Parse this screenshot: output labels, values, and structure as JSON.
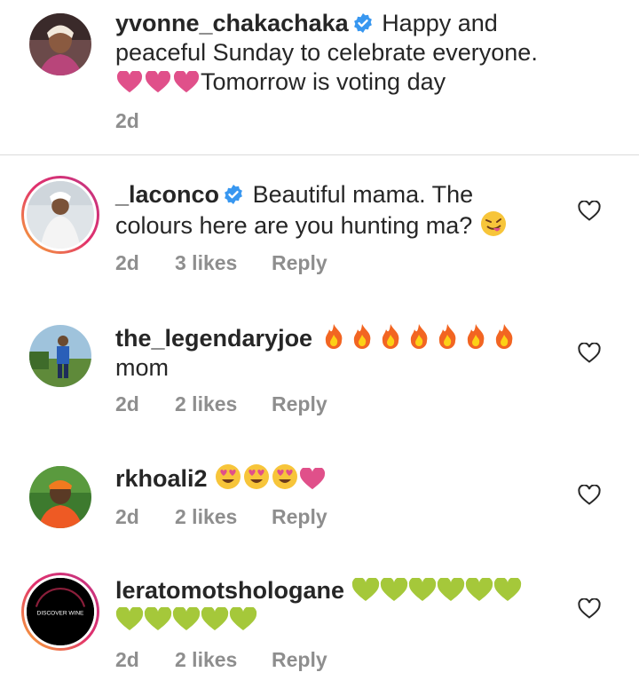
{
  "caption": {
    "username": "yvonne_chakachaka",
    "text_line1": "Happy and",
    "text_line2": "peaceful Sunday to celebrate everyone.",
    "text_line3": "Tomorrow is voting day",
    "time": "2d"
  },
  "comments": [
    {
      "username": "_laconco",
      "verified": true,
      "text1": "Beautiful mama. The",
      "text2": "colours here are you hunting ma?",
      "time": "2d",
      "likes": "3 likes",
      "reply": "Reply"
    },
    {
      "username": "the_legendaryjoe",
      "text2": "mom",
      "time": "2d",
      "likes": "2 likes",
      "reply": "Reply"
    },
    {
      "username": "rkhoali2",
      "time": "2d",
      "likes": "2 likes",
      "reply": "Reply"
    },
    {
      "username": "leratomotshologane",
      "time": "2d",
      "likes": "2 likes",
      "reply": "Reply",
      "avatar_text": "DISCOVER WINE"
    }
  ],
  "colors": {
    "verified": "#3897f0",
    "pink_heart": "#e0508a",
    "green_heart": "#a5c83a",
    "muted": "#8e8e8e"
  }
}
